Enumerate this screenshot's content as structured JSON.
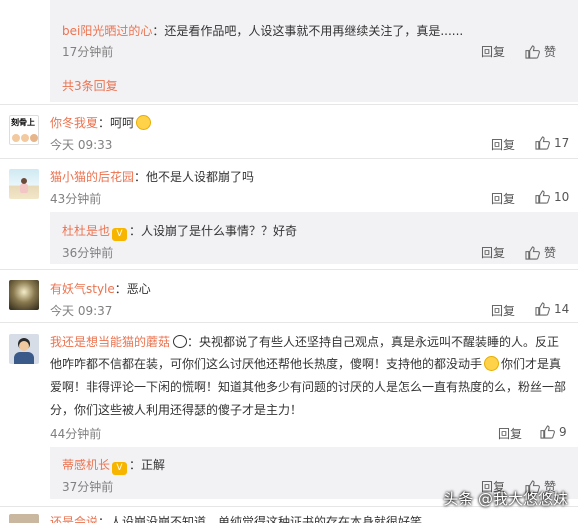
{
  "c0": {
    "reply_name": "bei阳光晒过的心",
    "reply_text": "：还是看作品吧，人设这事就不用再继续关注了，真是......",
    "time": "17分钟前",
    "reply_btn": "回复",
    "like_label": "赞",
    "more": "共3条回复"
  },
  "c1": {
    "avatar_text": "刻骨上",
    "name": "你冬我夏",
    "text": "：呵呵",
    "time": "今天 09:33",
    "reply_btn": "回复",
    "likes": "17"
  },
  "c2": {
    "name": "猫小猫的后花园",
    "text": "：他不是人设都崩了吗",
    "time": "43分钟前",
    "reply_btn": "回复",
    "likes": "10",
    "sub": {
      "name": "杜杜是也",
      "text": "：人设崩了是什么事情？？好奇",
      "time": "36分钟前",
      "reply_btn": "回复",
      "like_label": "赞"
    }
  },
  "c3": {
    "name": "有妖气style",
    "text": "：恶心",
    "time": "今天 09:37",
    "reply_btn": "回复",
    "likes": "14"
  },
  "c4": {
    "name": "我还是想当能猫的蘑菇",
    "line1": "：央视都说了有些人还坚持自己观点，真是永远叫不醒装睡的人。反正",
    "line2a": "他咋咋都不信都在装，可你们这么讨厌他还帮他长热度，傻啊！支持他的都没动手",
    "line2b": "你们才是真",
    "line3": "爱啊！非得评论一下闲的慌啊！知道其他多少有问题的讨厌的人是怎么一直有热度的么，粉丝一部",
    "line4": "分，你们这些被人利用还得瑟的傻子才是主力！",
    "time": "44分钟前",
    "reply_btn": "回复",
    "likes": "9",
    "sub": {
      "name": "蒂感机长",
      "text": "：正解",
      "time": "37分钟前",
      "reply_btn": "回复",
      "like_label": "赞"
    }
  },
  "c5": {
    "name": "还是会说",
    "text": "：人设崩没崩不知道，单纯觉得这种证书的存在本身就很好笑"
  },
  "vip_badge": "V",
  "watermark": "头条 @我大悠悠妹",
  "colors": {
    "name": "#eb7350",
    "muted": "#808080",
    "reply_bg": "#f2f2f5"
  }
}
